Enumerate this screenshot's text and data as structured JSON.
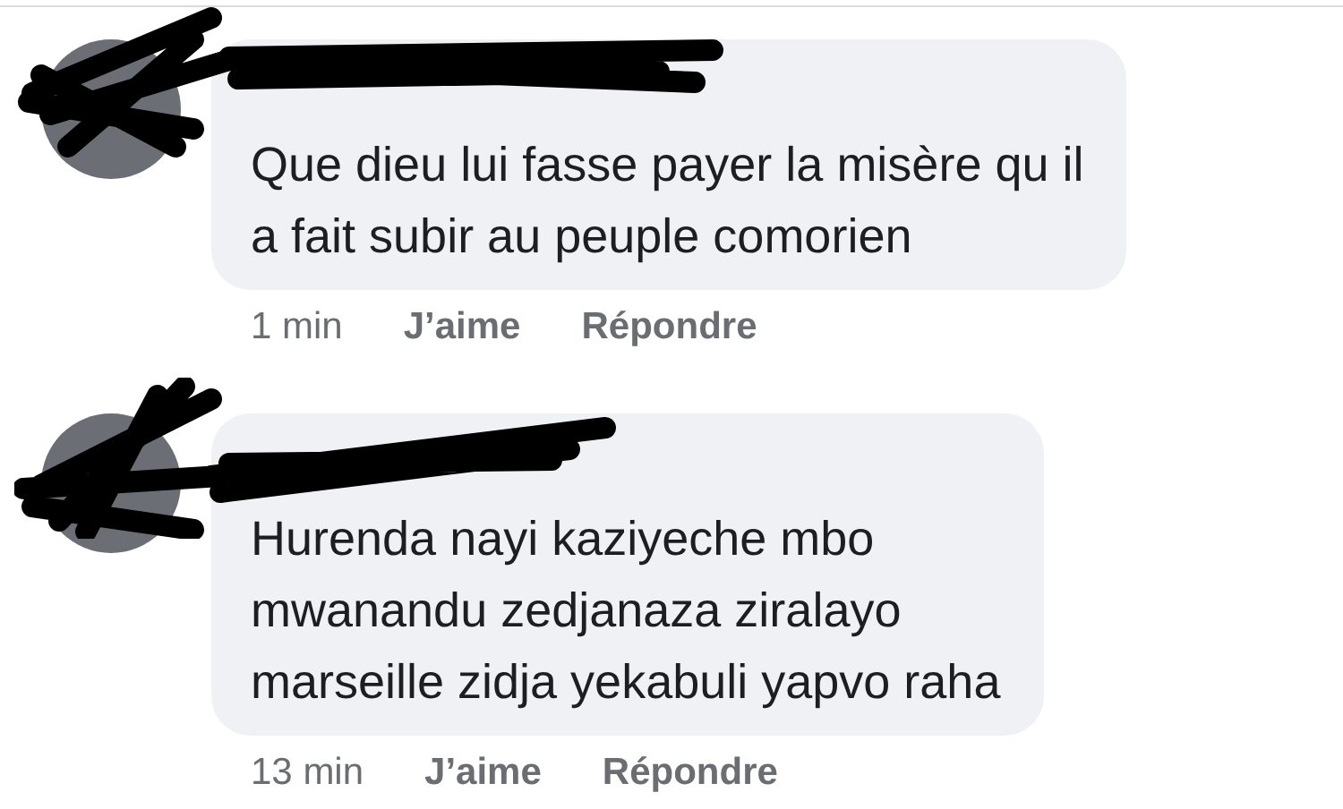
{
  "comments": [
    {
      "text": "Que dieu lui fasse payer la misère qu il\na fait subir au peuple comorien",
      "time": "1 min",
      "like": "J’aime",
      "reply": "Répondre"
    },
    {
      "text": "Hurenda nayi kaziyeche mbo\nmwanandu zedjanaza ziralayo\nmarseille zidja yekabuli yapvo raha",
      "time": "13 min",
      "like": "J’aime",
      "reply": "Répondre"
    }
  ]
}
